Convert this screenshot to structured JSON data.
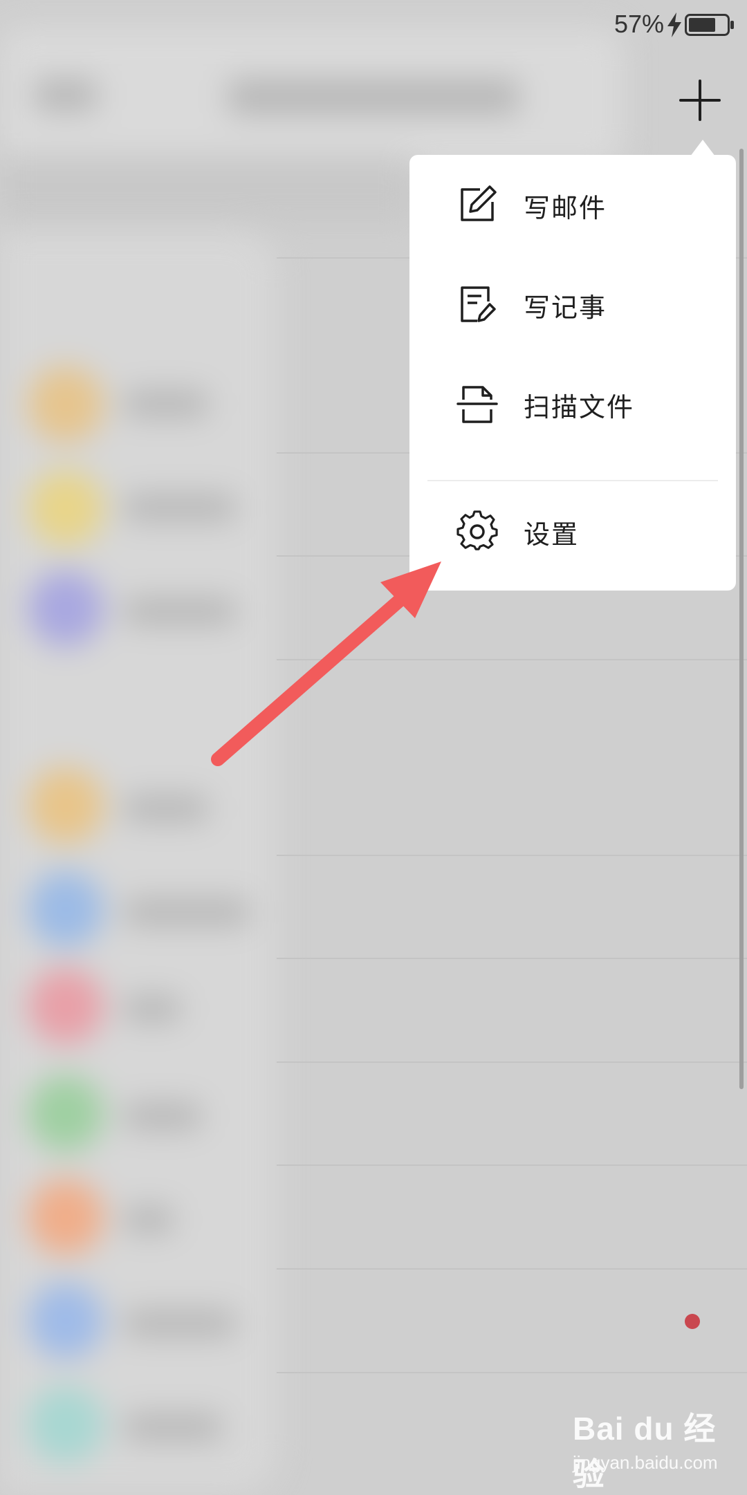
{
  "status_bar": {
    "battery_percent": "57%"
  },
  "header": {
    "add_button_icon": "plus-icon"
  },
  "popup_menu": {
    "items": [
      {
        "label": "写邮件",
        "icon": "compose-edit-icon"
      },
      {
        "label": "写记事",
        "icon": "note-edit-icon"
      },
      {
        "label": "扫描文件",
        "icon": "scan-document-icon"
      },
      {
        "label": "设置",
        "icon": "gear-icon"
      }
    ]
  },
  "annotation": {
    "arrow_color": "#f25b5b"
  },
  "watermark": {
    "logo_text": "Bai du 经验",
    "url": "jingyan.baidu.com"
  },
  "colors": {
    "background_dim": "#cfcfcf",
    "popup_bg": "#ffffff",
    "unread_dot": "#c9474f"
  }
}
